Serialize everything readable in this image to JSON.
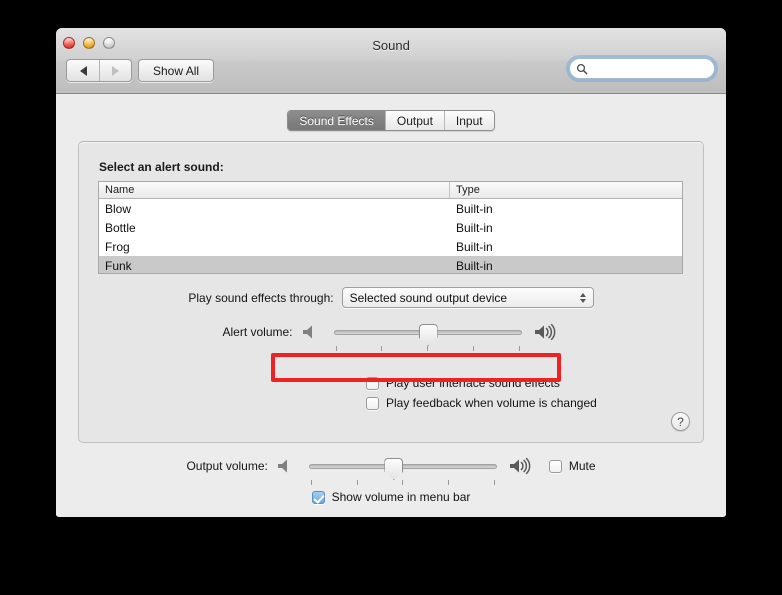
{
  "window": {
    "title": "Sound",
    "traffic_lights": [
      "close-button",
      "minimize-button",
      "zoom-button"
    ]
  },
  "toolbar": {
    "back_icon": "back-arrow-icon",
    "forward_icon": "forward-arrow-icon",
    "show_all_label": "Show All",
    "search": {
      "value": "",
      "placeholder": "",
      "icon": "search-icon"
    }
  },
  "tabs": [
    {
      "label": "Sound Effects",
      "active": true
    },
    {
      "label": "Output",
      "active": false
    },
    {
      "label": "Input",
      "active": false
    }
  ],
  "sound_effects": {
    "group_label": "Select an alert sound:",
    "table": {
      "columns": [
        "Name",
        "Type"
      ],
      "rows": [
        {
          "name": "Blow",
          "type": "Built-in",
          "selected": false
        },
        {
          "name": "Bottle",
          "type": "Built-in",
          "selected": false
        },
        {
          "name": "Frog",
          "type": "Built-in",
          "selected": false
        },
        {
          "name": "Funk",
          "type": "Built-in",
          "selected": true
        }
      ]
    },
    "play_through": {
      "label": "Play sound effects through:",
      "value": "Selected sound output device"
    },
    "alert_volume": {
      "label": "Alert volume:",
      "value_percent": 50,
      "low_icon": "speaker-low-icon",
      "high_icon": "speaker-high-icon",
      "tick_count": 5
    },
    "checkbox_ui_sounds": {
      "label": "Play user interface sound effects",
      "checked": false,
      "highlighted": true
    },
    "checkbox_volume_feedback": {
      "label": "Play feedback when volume is changed",
      "checked": false,
      "highlighted": false
    },
    "help_button": "?"
  },
  "output": {
    "volume": {
      "label": "Output volume:",
      "value_percent": 45,
      "low_icon": "speaker-low-icon",
      "high_icon": "speaker-high-icon",
      "tick_count": 5
    },
    "mute": {
      "label": "Mute",
      "checked": false
    },
    "show_in_menu_bar": {
      "label": "Show volume in menu bar",
      "checked": true
    }
  },
  "colors": {
    "annotation": "#ee2222",
    "selection": "#c9c9c9",
    "checkbox_accent": "#6fa9de",
    "tab_active": "#777777"
  }
}
